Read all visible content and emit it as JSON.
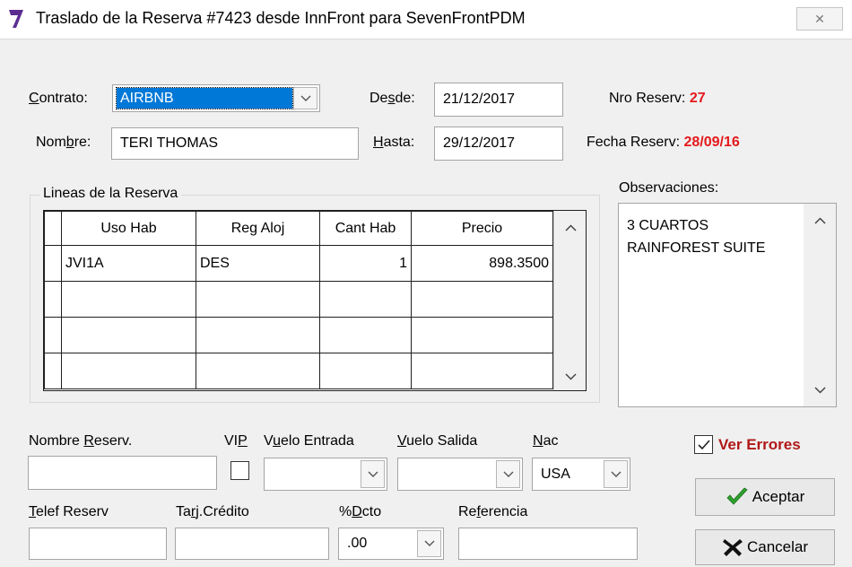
{
  "window": {
    "title": "Traslado de la Reserva #7423 desde InnFront para SevenFrontPDM",
    "close_glyph": "✕"
  },
  "form": {
    "contrato_label": "Contrato:",
    "contrato_value": "AIRBNB",
    "nombre_label": "Nombre:",
    "nombre_value": "TERI THOMAS",
    "desde_label": "Desde:",
    "desde_value": "21/12/2017",
    "hasta_label": "Hasta:",
    "hasta_value": "29/12/2017",
    "nro_reserv_label": "Nro Reserv:",
    "nro_reserv_value": "27",
    "fecha_reserv_label": "Fecha Reserv:",
    "fecha_reserv_value": "28/09/16"
  },
  "lines": {
    "group_label": "Lineas de la Reserva",
    "columns": [
      "Uso Hab",
      "Reg Aloj",
      "Cant Hab",
      "Precio"
    ],
    "rows": [
      [
        "JVI1A",
        "DES",
        "1",
        "898.3500"
      ],
      [
        "",
        "",
        "",
        ""
      ],
      [
        "",
        "",
        "",
        ""
      ],
      [
        "",
        "",
        "",
        ""
      ]
    ]
  },
  "observaciones": {
    "label": "Observaciones:",
    "lines": [
      "3 CUARTOS",
      "RAINFOREST SUITE"
    ]
  },
  "bottom": {
    "nombre_reserv_label": "Nombre Reserv.",
    "vip_label": "VIP",
    "vuelo_entrada_label": "Vuelo Entrada",
    "vuelo_salida_label": "Vuelo Salida",
    "nac_label": "Nac",
    "nac_value": "USA",
    "telef_label": "Telef Reserv",
    "tarj_label": "Tarj.Crédito",
    "dcto_label": "%Dcto",
    "dcto_value": ".00",
    "referencia_label": "Referencia"
  },
  "actions": {
    "ver_errores_label": "Ver Errores",
    "ver_errores_checked": true,
    "aceptar_label": "Aceptar",
    "cancelar_label": "Cancelar"
  },
  "colors": {
    "accent_red": "#e4191c",
    "selection_blue": "#0078d7",
    "check_green": "#2ea12e"
  }
}
